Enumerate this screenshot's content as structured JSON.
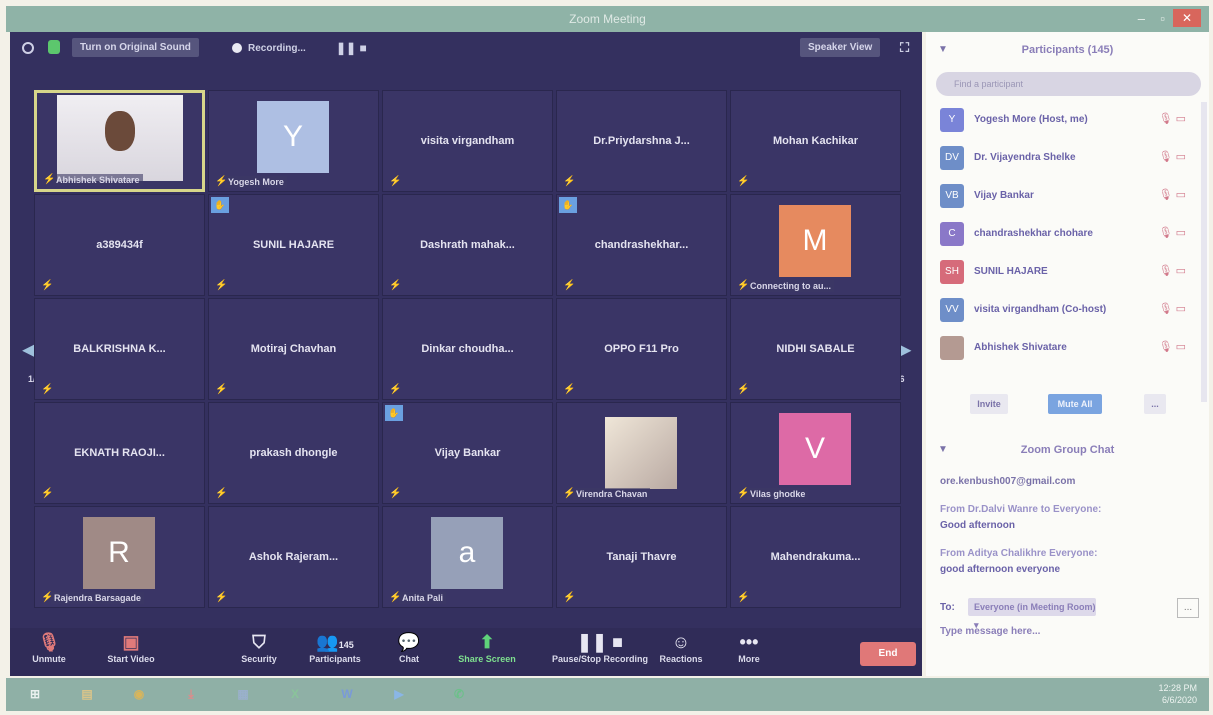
{
  "window": {
    "title": "Zoom Meeting",
    "min": "–",
    "max": "▫",
    "close": "✕"
  },
  "topbar": {
    "original_sound": "Turn on Original Sound",
    "recording": "Recording...",
    "speaker_view": "Speaker View"
  },
  "tiles": [
    {
      "name": "",
      "caption": "Abhishek Shivatare",
      "type": "video"
    },
    {
      "name": "",
      "caption": "Yogesh More",
      "type": "avatar",
      "letter": "Y",
      "color": "#aebfe3"
    },
    {
      "name": "visita virgandham",
      "type": "text"
    },
    {
      "name": "Dr.Priydarshna J...",
      "type": "text"
    },
    {
      "name": "Mohan Kachikar",
      "type": "text"
    },
    {
      "name": "a389434f",
      "type": "text"
    },
    {
      "name": "SUNIL HAJARE",
      "type": "text",
      "badge": true
    },
    {
      "name": "Dashrath mahak...",
      "type": "text"
    },
    {
      "name": "chandrashekhar...",
      "type": "text",
      "badge": true
    },
    {
      "name": "",
      "caption": "Connecting to au...",
      "type": "avatar",
      "letter": "M",
      "color": "#e68a5f"
    },
    {
      "name": "BALKRISHNA K...",
      "type": "text"
    },
    {
      "name": "Motiraj Chavhan",
      "type": "text"
    },
    {
      "name": "Dinkar choudha...",
      "type": "text"
    },
    {
      "name": "OPPO F11 Pro",
      "type": "text"
    },
    {
      "name": "NIDHI SABALE",
      "type": "text"
    },
    {
      "name": "EKNATH RAOJI...",
      "type": "text"
    },
    {
      "name": "prakash dhongle",
      "type": "text"
    },
    {
      "name": "Vijay Bankar",
      "type": "text",
      "badge": true
    },
    {
      "name": "",
      "caption": "Virendra Chavan",
      "type": "photo"
    },
    {
      "name": "",
      "caption": "Vilas ghodke",
      "type": "avatar",
      "letter": "V",
      "color": "#dd6aa6"
    },
    {
      "name": "",
      "caption": "Rajendra Barsagade",
      "type": "avatar",
      "letter": "R",
      "color": "#a08a86"
    },
    {
      "name": "Ashok Rajeram...",
      "type": "text"
    },
    {
      "name": "",
      "caption": "Anita Pali",
      "type": "avatar",
      "letter": "a",
      "color": "#96a0b8"
    },
    {
      "name": "Tanaji Thavre",
      "type": "text"
    },
    {
      "name": "Mahendrakuma...",
      "type": "text"
    }
  ],
  "nav": {
    "left_page": "1/6",
    "right_page": "1/6"
  },
  "toolbar": {
    "unmute": "Unmute",
    "start_video": "Start Video",
    "security": "Security",
    "participants": "Participants",
    "participants_count": "145",
    "chat": "Chat",
    "share_screen": "Share Screen",
    "record": "Pause/Stop Recording",
    "reactions": "Reactions",
    "more": "More",
    "end": "End"
  },
  "participants_panel": {
    "title": "Participants (145)",
    "search_placeholder": "Find a participant",
    "list": [
      {
        "initials": "Y",
        "name": "Yogesh More (Host, me)",
        "color": "#7a84d8"
      },
      {
        "initials": "DV",
        "name": "Dr. Vijayendra Shelke",
        "color": "#6e8ec8"
      },
      {
        "initials": "VB",
        "name": "Vijay Bankar",
        "color": "#6e8ec8"
      },
      {
        "initials": "C",
        "name": "chandrashekhar chohare",
        "color": "#8a78c8"
      },
      {
        "initials": "SH",
        "name": "SUNIL HAJARE",
        "color": "#d66b7a"
      },
      {
        "initials": "VV",
        "name": "visita virgandham (Co-host)",
        "color": "#6e8ec8"
      },
      {
        "initials": "",
        "name": "Abhishek Shivatare",
        "color": "#b49a92"
      }
    ],
    "invite": "Invite",
    "mute_all": "Mute All",
    "more": "..."
  },
  "chat": {
    "title": "Zoom Group Chat",
    "lines": [
      {
        "text": "ore.kenbush007@gmail.com",
        "style": "muted"
      },
      {
        "text": "From Dr.Dalvi Wanre to Everyone:",
        "style": "from"
      },
      {
        "text": "Good afternoon",
        "style": "msg"
      },
      {
        "text": "From Aditya Chalikhre Everyone:",
        "style": "from"
      },
      {
        "text": "good afternoon everyone",
        "style": "msg"
      }
    ],
    "to_label": "To:",
    "to_value": "Everyone (in Meeting Room) ▾",
    "more": "...",
    "input_placeholder": "Type message here..."
  },
  "taskbar": {
    "apps": [
      "⊞",
      "▤",
      "◉",
      "⤓",
      "▦",
      "X",
      "W",
      "▶",
      "✆"
    ],
    "time": "12:28 PM",
    "date": "6/6/2020"
  }
}
